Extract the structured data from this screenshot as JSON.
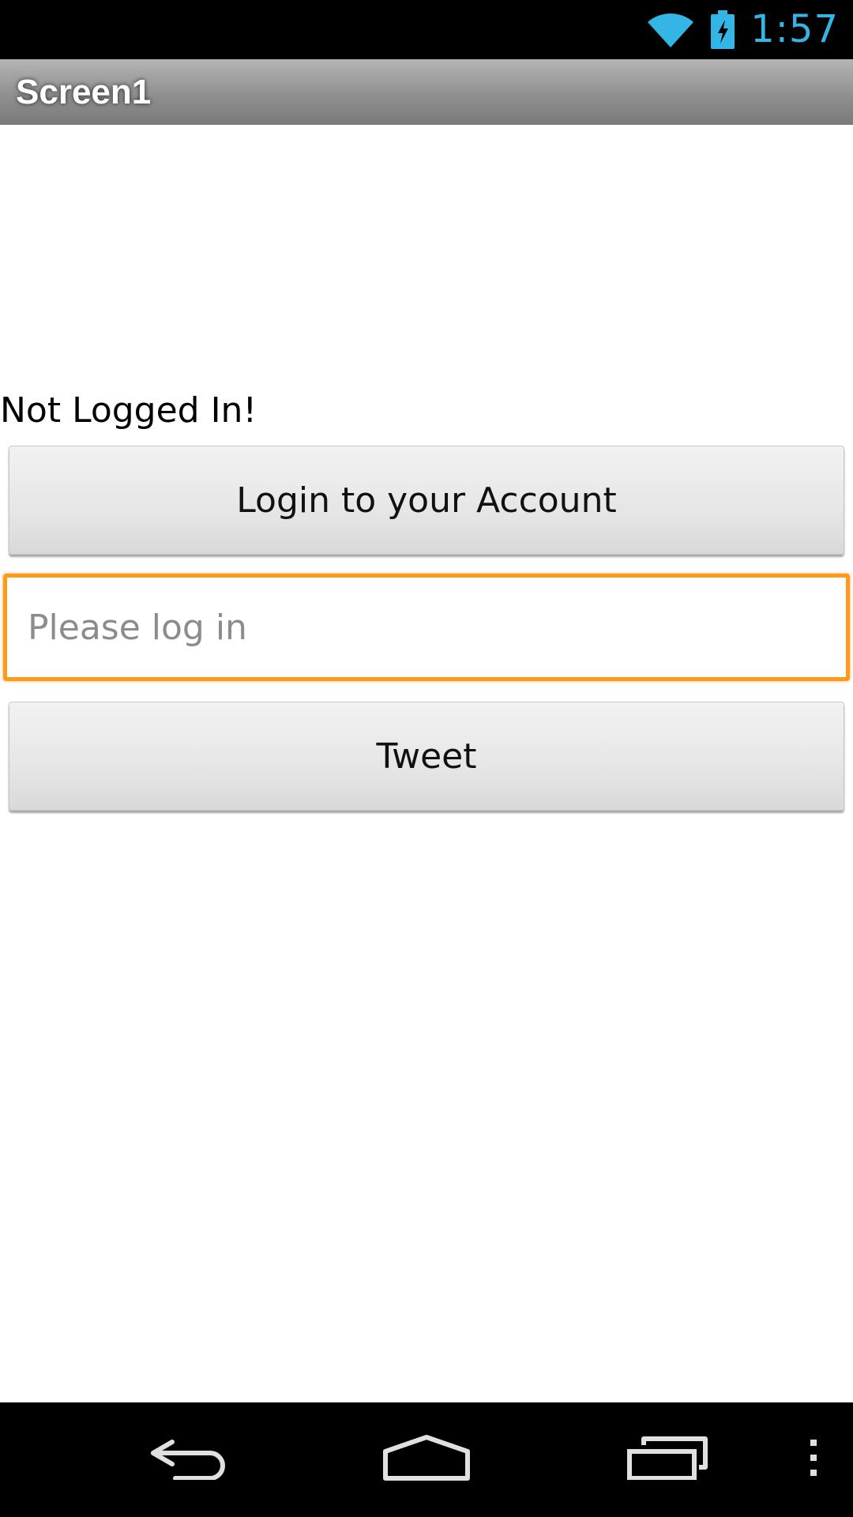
{
  "status_bar": {
    "time": "1:57",
    "icons": [
      "wifi-icon",
      "battery-charging-icon"
    ],
    "clock_color": "#33b5e5"
  },
  "title_bar": {
    "title": "Screen1"
  },
  "main": {
    "status_label": "Not Logged In!",
    "login_button_label": "Login to your Account",
    "input": {
      "value": "",
      "placeholder": "Please log in",
      "focus_color": "#ff9a1c"
    },
    "tweet_button_label": "Tweet"
  },
  "nav_bar": {
    "icons": [
      "back-icon",
      "home-icon",
      "recents-icon",
      "overflow-menu-icon"
    ]
  }
}
